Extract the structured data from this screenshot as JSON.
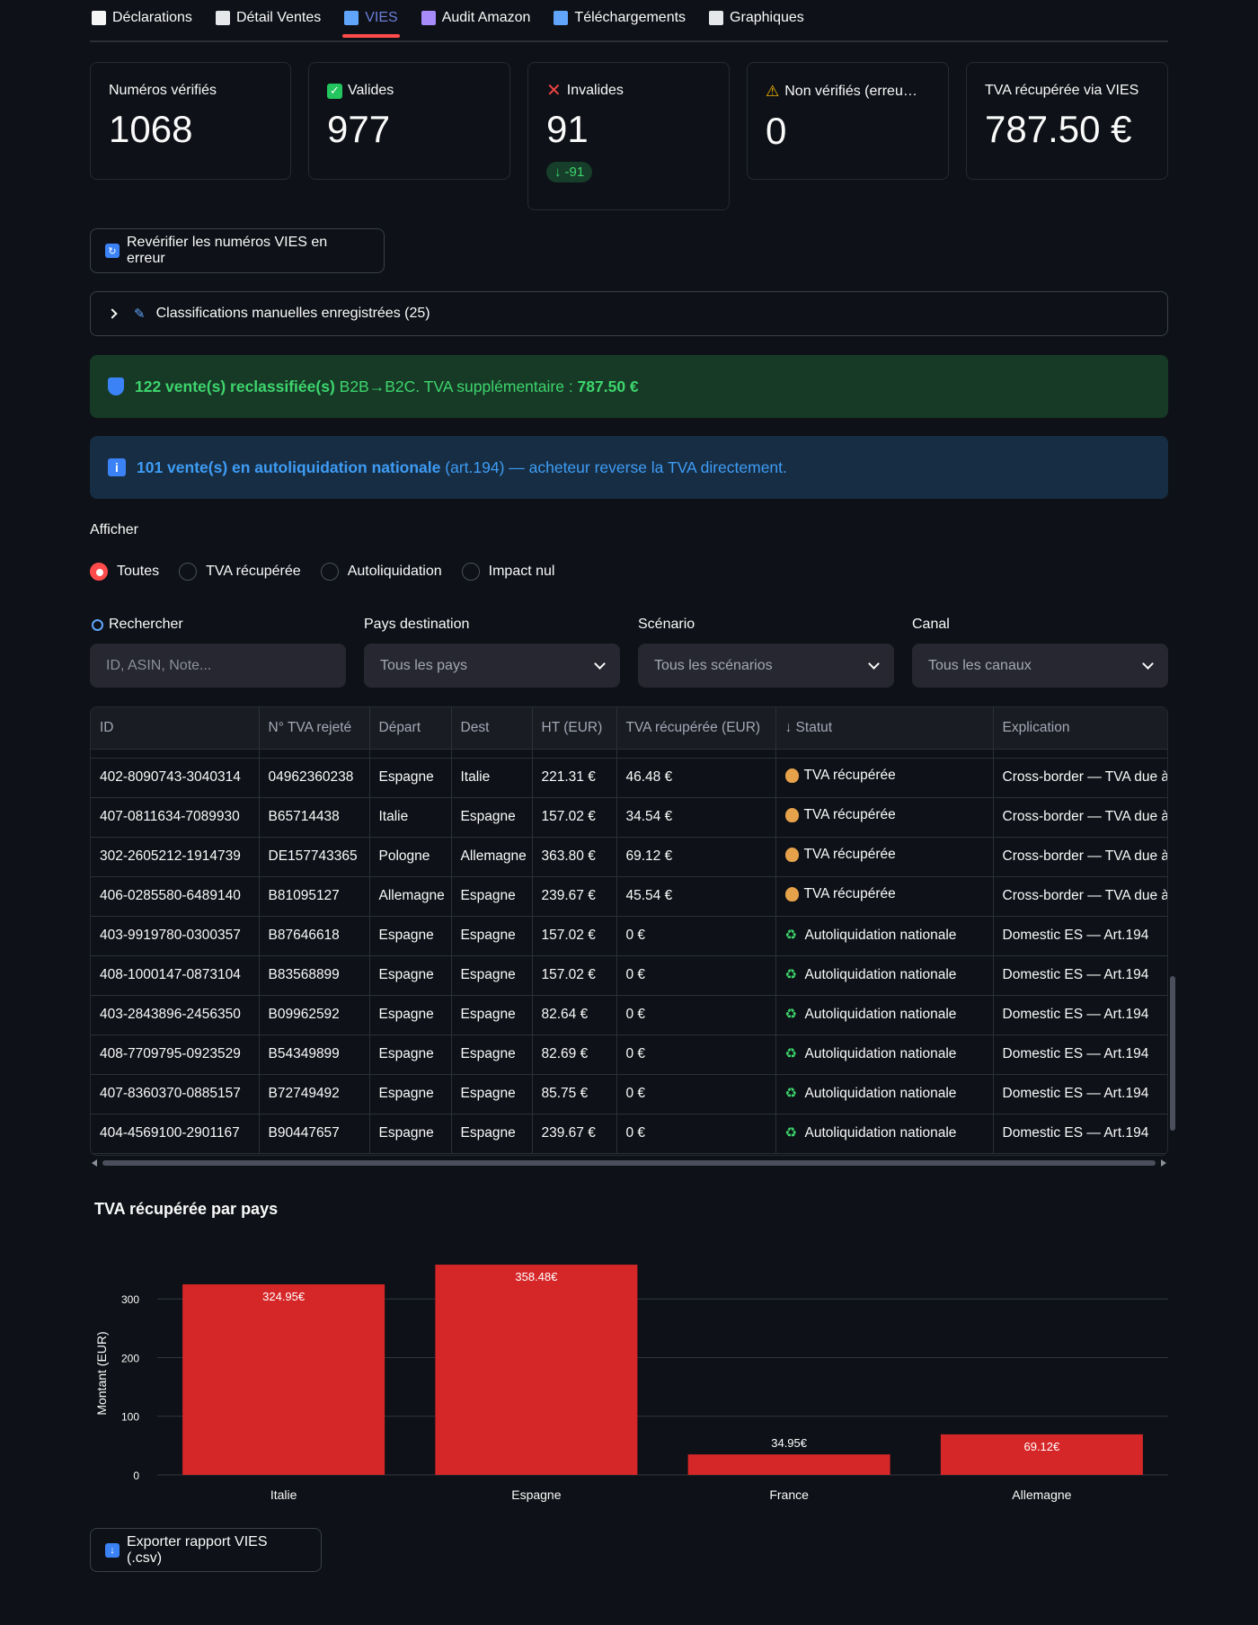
{
  "tabs": [
    {
      "label": "Déclarations",
      "icon": "clipboard-icon",
      "color": "#f5f5f5"
    },
    {
      "label": "Détail Ventes",
      "icon": "page-icon",
      "color": "#e5e7eb"
    },
    {
      "label": "VIES",
      "icon": "magnifier-icon",
      "color": "#60a5fa"
    },
    {
      "label": "Audit Amazon",
      "icon": "detective-icon",
      "color": "#a78bfa"
    },
    {
      "label": "Téléchargements",
      "icon": "inbox-icon",
      "color": "#60a5fa"
    },
    {
      "label": "Graphiques",
      "icon": "chart-icon",
      "color": "#e5e7eb"
    }
  ],
  "metrics": {
    "verified": {
      "label": "Numéros vérifiés",
      "value": "1068"
    },
    "valid": {
      "label": "Valides",
      "value": "977"
    },
    "invalid": {
      "label": "Invalides",
      "value": "91",
      "delta": "-91"
    },
    "unverified": {
      "label": "Non vérifiés (erreu…",
      "value": "0"
    },
    "recovered": {
      "label": "TVA récupérée via VIES",
      "value": "787.50 €"
    }
  },
  "recheck_button": "Revérifier les numéros VIES en erreur",
  "expander_label": "Classifications manuelles enregistrées (25)",
  "alerts": {
    "success_bold": "122 vente(s) reclassifiée(s)",
    "success_text": " B2B→B2C. TVA supplémentaire : ",
    "success_amount": "787.50 €",
    "info_bold": "101 vente(s) en autoliquidation nationale",
    "info_text": " (art.194) — acheteur reverse la TVA directement."
  },
  "filter": {
    "label": "Afficher",
    "options": [
      "Toutes",
      "TVA récupérée",
      "Autoliquidation",
      "Impact nul"
    ],
    "selected": "Toutes"
  },
  "search": {
    "label": "Rechercher",
    "placeholder": "ID, ASIN, Note..."
  },
  "selects": {
    "pays": {
      "label": "Pays destination",
      "value": "Tous les pays"
    },
    "scenario": {
      "label": "Scénario",
      "value": "Tous les scénarios"
    },
    "canal": {
      "label": "Canal",
      "value": "Tous les canaux"
    }
  },
  "table": {
    "columns": [
      "ID",
      "N° TVA rejeté",
      "Départ",
      "Dest",
      "HT (EUR)",
      "TVA récupérée (EUR)",
      "↓ Statut",
      "Explication"
    ],
    "rows": [
      [
        "402-8090743-3040314",
        "04962360238",
        "Espagne",
        "Italie",
        "221.31 €",
        "46.48 €",
        "TVA récupérée",
        "Cross-border — TVA due à"
      ],
      [
        "407-0811634-7089930",
        "B65714438",
        "Italie",
        "Espagne",
        "157.02 €",
        "34.54 €",
        "TVA récupérée",
        "Cross-border — TVA due à"
      ],
      [
        "302-2605212-1914739",
        "DE157743365",
        "Pologne",
        "Allemagne",
        "363.80 €",
        "69.12 €",
        "TVA récupérée",
        "Cross-border — TVA due à"
      ],
      [
        "406-0285580-6489140",
        "B81095127",
        "Allemagne",
        "Espagne",
        "239.67 €",
        "45.54 €",
        "TVA récupérée",
        "Cross-border — TVA due à"
      ],
      [
        "403-9919780-0300357",
        "B87646618",
        "Espagne",
        "Espagne",
        "157.02 €",
        "0 €",
        "Autoliquidation nationale",
        "Domestic ES — Art.194"
      ],
      [
        "408-1000147-0873104",
        "B83568899",
        "Espagne",
        "Espagne",
        "157.02 €",
        "0 €",
        "Autoliquidation nationale",
        "Domestic ES — Art.194"
      ],
      [
        "403-2843896-2456350",
        "B09962592",
        "Espagne",
        "Espagne",
        "82.64 €",
        "0 €",
        "Autoliquidation nationale",
        "Domestic ES — Art.194"
      ],
      [
        "408-7709795-0923529",
        "B54349899",
        "Espagne",
        "Espagne",
        "82.69 €",
        "0 €",
        "Autoliquidation nationale",
        "Domestic ES — Art.194"
      ],
      [
        "407-8360370-0885157",
        "B72749492",
        "Espagne",
        "Espagne",
        "85.75 €",
        "0 €",
        "Autoliquidation nationale",
        "Domestic ES — Art.194"
      ],
      [
        "404-4569100-2901167",
        "B90447657",
        "Espagne",
        "Espagne",
        "239.67 €",
        "0 €",
        "Autoliquidation nationale",
        "Domestic ES — Art.194"
      ]
    ]
  },
  "chart_title": "TVA récupérée par pays",
  "chart_data": {
    "type": "bar",
    "categories": [
      "Italie",
      "Espagne",
      "France",
      "Allemagne"
    ],
    "values": [
      324.95,
      358.48,
      34.95,
      69.12
    ],
    "data_labels": [
      "324.95€",
      "358.48€",
      "34.95€",
      "69.12€"
    ],
    "ylabel": "Montant (EUR)",
    "yticks": [
      0,
      100,
      200,
      300
    ],
    "ylim": [
      0,
      377
    ],
    "bar_color": "#d62728",
    "grid": true
  },
  "export_button": "Exporter rapport VIES (.csv)",
  "colors": {
    "accent": "#ff4b4b",
    "success": "#3dd56d",
    "info": "#3e9cf5",
    "background": "#0e1117"
  }
}
